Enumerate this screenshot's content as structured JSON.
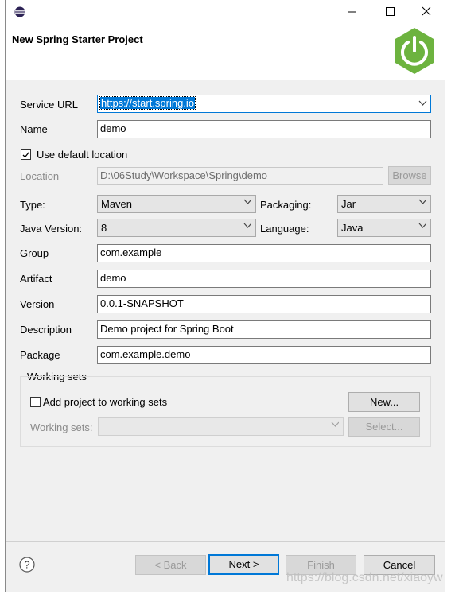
{
  "window": {
    "title": "New Spring Starter Project",
    "controls": {
      "minimize": "—",
      "maximize": "☐",
      "close": "✕"
    }
  },
  "form": {
    "service_url": {
      "label": "Service URL",
      "value": "https://start.spring.io"
    },
    "name": {
      "label": "Name",
      "value": "demo"
    },
    "use_default_location": {
      "label": "Use default location",
      "checked": true
    },
    "location": {
      "label": "Location",
      "value": "D:\\06Study\\Workspace\\Spring\\demo",
      "browse_label": "Browse"
    },
    "type": {
      "label": "Type:",
      "value": "Maven"
    },
    "packaging": {
      "label": "Packaging:",
      "value": "Jar"
    },
    "java_version": {
      "label": "Java Version:",
      "value": "8"
    },
    "language": {
      "label": "Language:",
      "value": "Java"
    },
    "group": {
      "label": "Group",
      "value": "com.example"
    },
    "artifact": {
      "label": "Artifact",
      "value": "demo"
    },
    "version": {
      "label": "Version",
      "value": "0.0.1-SNAPSHOT"
    },
    "description": {
      "label": "Description",
      "value": "Demo project for Spring Boot"
    },
    "package": {
      "label": "Package",
      "value": "com.example.demo"
    }
  },
  "working_sets": {
    "title": "Working sets",
    "add_label": "Add project to working sets",
    "new_button": "New...",
    "working_sets_label": "Working sets:",
    "select_button": "Select..."
  },
  "footer": {
    "back": "< Back",
    "next": "Next >",
    "finish": "Finish",
    "cancel": "Cancel"
  },
  "watermark": "https://blog.csdn.net/xiaoyw",
  "colors": {
    "accent": "#0078d7",
    "spring_green": "#6db33f"
  },
  "icons": [
    "eclipse-icon",
    "spring-power-icon",
    "help-icon",
    "chevron-down-icon",
    "checkmark-icon"
  ]
}
